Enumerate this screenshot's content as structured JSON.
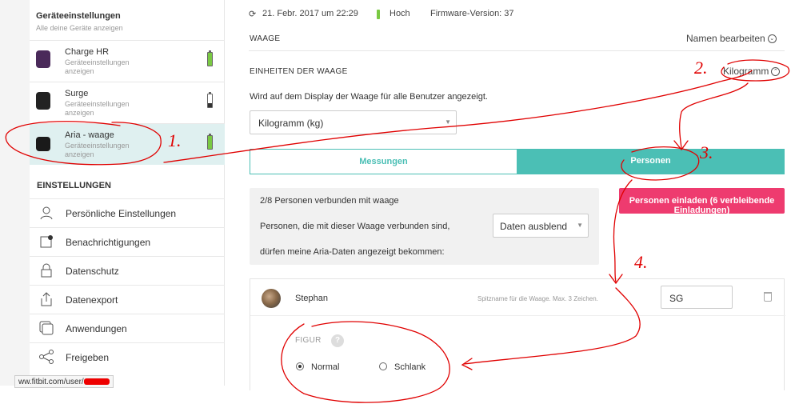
{
  "sidebar": {
    "section_title": "Geräteeinstellungen",
    "section_subtitle": "Alle deine Geräte anzeigen",
    "devices": [
      {
        "name": "Charge HR",
        "subtitle": "Geräteeinstellungen anzeigen",
        "battery": 1.0,
        "battery_color": "#7ac943"
      },
      {
        "name": "Surge",
        "subtitle": "Geräteeinstellungen anzeigen",
        "battery": 0.3,
        "battery_color": "#333333"
      },
      {
        "name": "Aria - waage",
        "subtitle": "Geräteeinstellungen anzeigen",
        "battery": 1.0,
        "battery_color": "#7ac943"
      }
    ],
    "settings_title": "EINSTELLUNGEN",
    "menu": [
      {
        "label": "Persönliche Einstellungen",
        "icon": "person-icon"
      },
      {
        "label": "Benachrichtigungen",
        "icon": "notification-icon"
      },
      {
        "label": "Datenschutz",
        "icon": "lock-icon"
      },
      {
        "label": "Datenexport",
        "icon": "export-icon"
      },
      {
        "label": "Anwendungen",
        "icon": "apps-icon"
      },
      {
        "label": "Freigeben",
        "icon": "share-icon"
      }
    ],
    "status_url": "ww.fitbit.com/user/"
  },
  "header": {
    "sync_time": "21. Febr. 2017 um 22:29",
    "battery_level": "Hoch",
    "firmware": "Firmware-Version: 37"
  },
  "main": {
    "device_heading": "WAAGE",
    "rename_label": "Namen bearbeiten",
    "units_heading": "EINHEITEN DER WAAGE",
    "units_value_label": "Kilogramm",
    "units_description": "Wird auf dem Display der Waage für alle Benutzer angezeigt.",
    "units_select_value": "Kilogramm (kg)",
    "tabs": [
      {
        "label": "Messungen",
        "active": false
      },
      {
        "label": "Personen",
        "active": true
      }
    ],
    "connected_info": "2/8 Personen verbunden mit waage",
    "share_text_1": "Personen, die mit dieser Waage verbunden sind,",
    "share_text_2": "dürfen meine Aria-Daten angezeigt bekommen:",
    "share_select_value": "Daten ausblend",
    "invite_button": "Personen einladen (6 verbleibende Einladungen)",
    "person": {
      "name": "Stephan",
      "nickname_hint": "Spitzname für die Waage. Max. 3 Zeichen.",
      "nickname": "SG",
      "figure_label": "FIGUR",
      "figure_help": "?",
      "options": [
        {
          "label": "Normal",
          "selected": true
        },
        {
          "label": "Schlank",
          "selected": false
        }
      ]
    }
  },
  "annotations": [
    "1.",
    "2.",
    "3.",
    "4."
  ],
  "colors": {
    "accent": "#4bbfb5",
    "invite": "#ee3b6f",
    "annotation": "#e00000",
    "battery_high": "#7ac943"
  }
}
